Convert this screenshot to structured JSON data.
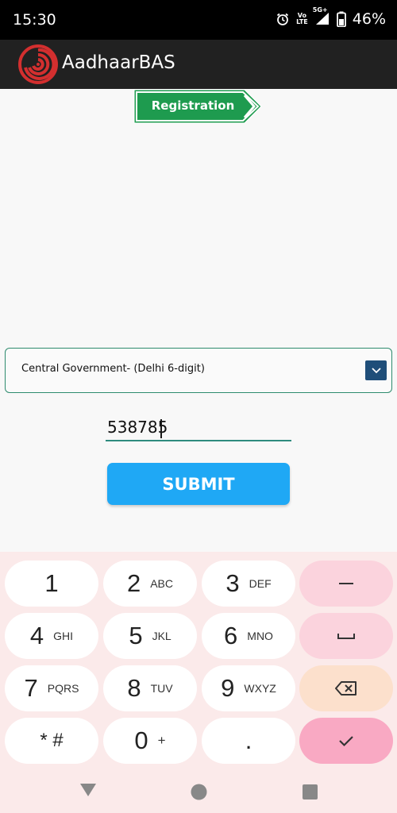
{
  "status_bar": {
    "time": "15:30",
    "indicator_vo": "Vo",
    "indicator_lte": "LTE",
    "network": "5G+",
    "battery": "46%"
  },
  "app_bar": {
    "title": "AadhaarBAS",
    "logo_icon": "fingerprint-spiral-icon",
    "colors": {
      "background": "#212121",
      "logo": "#d32f2f"
    }
  },
  "banner": {
    "label": "Registration",
    "color": "#1e9b4f"
  },
  "dropdown": {
    "selected": "Central Government- (Delhi 6-digit)"
  },
  "code_input": {
    "value": "538785"
  },
  "submit": {
    "label": "SUBMIT",
    "color": "#1fa8f5"
  },
  "keyboard": {
    "keys": [
      {
        "num": "1",
        "letters": ""
      },
      {
        "num": "2",
        "letters": "ABC"
      },
      {
        "num": "3",
        "letters": "DEF"
      },
      {
        "num": "4",
        "letters": "GHI"
      },
      {
        "num": "5",
        "letters": "JKL"
      },
      {
        "num": "6",
        "letters": "MNO"
      },
      {
        "num": "7",
        "letters": "PQRS"
      },
      {
        "num": "8",
        "letters": "TUV"
      },
      {
        "num": "9",
        "letters": "WXYZ"
      },
      {
        "num": "* #",
        "letters": ""
      },
      {
        "num": "0",
        "letters": "+"
      },
      {
        "num": ".",
        "letters": ""
      }
    ],
    "function_keys": [
      "minus-icon",
      "space-icon",
      "backspace-icon",
      "check-icon"
    ]
  },
  "nav_bar": {
    "icons": [
      "back-triangle-icon",
      "home-circle-icon",
      "recents-square-icon"
    ]
  }
}
